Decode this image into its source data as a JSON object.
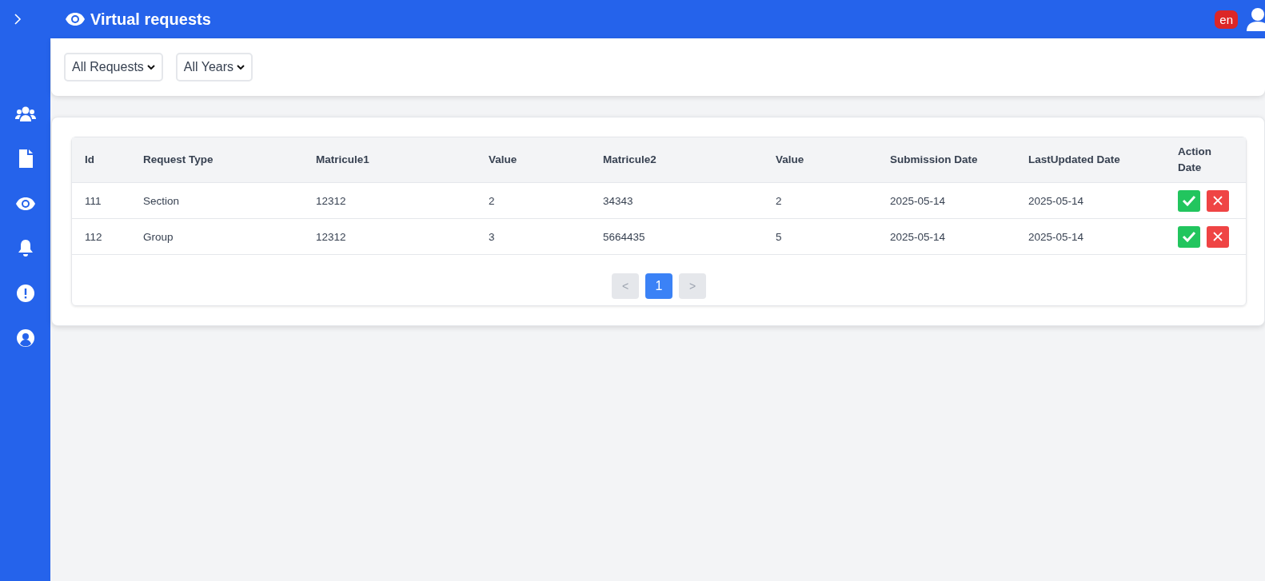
{
  "header": {
    "title": "Virtual requests",
    "language": "en"
  },
  "filters": [
    {
      "value": "All Requests"
    },
    {
      "value": "All Years"
    }
  ],
  "table": {
    "columns": [
      "Id",
      "Request Type",
      "Matricule1",
      "Value",
      "Matricule2",
      "Value",
      "Submission Date",
      "LastUpdated Date",
      "Action Date"
    ],
    "rows": [
      {
        "cells": [
          "111",
          "Section",
          "12312",
          "2",
          "34343",
          "2",
          "2025-05-14",
          "2025-05-14"
        ]
      },
      {
        "cells": [
          "112",
          "Group",
          "12312",
          "3",
          "5664435",
          "5",
          "2025-05-14",
          "2025-05-14"
        ]
      }
    ]
  },
  "pagination": {
    "prev": {
      "label": "<",
      "disabled": true
    },
    "pages": [
      {
        "label": "1",
        "selected": true
      }
    ],
    "next": {
      "label": ">",
      "disabled": true
    }
  }
}
